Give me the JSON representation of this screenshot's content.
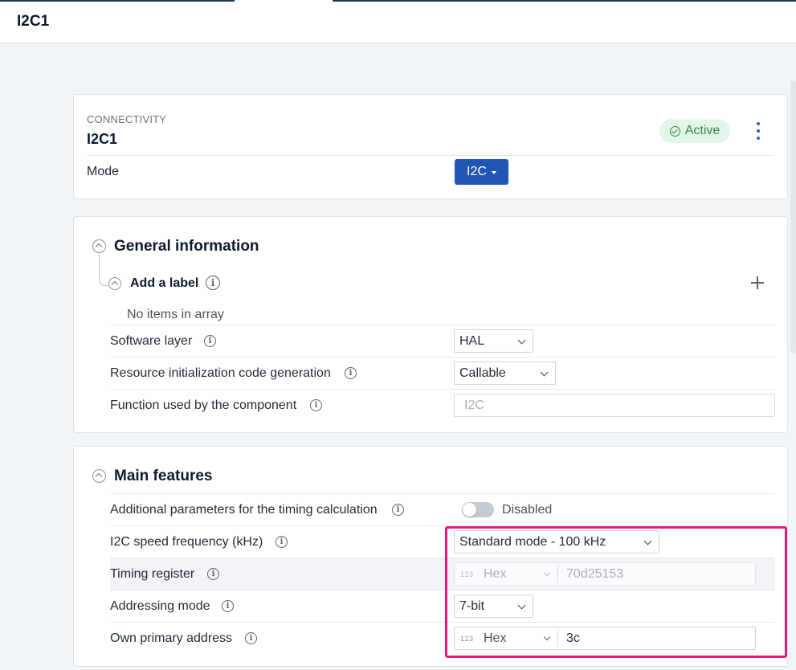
{
  "header": {
    "title": "I2C1"
  },
  "component": {
    "category": "CONNECTIVITY",
    "name": "I2C1",
    "status": "Active",
    "status_color": "#2e8a48",
    "menu_icon": "kebab-icon",
    "mode_label": "Mode",
    "mode_value": "I2C",
    "accent": "#2156b4"
  },
  "general": {
    "title": "General information",
    "add_label": "Add a label",
    "empty_text": "No items in array",
    "software_layer": {
      "label": "Software layer",
      "value": "HAL"
    },
    "init_codegen": {
      "label": "Resource initialization code generation",
      "value": "Callable"
    },
    "function_used": {
      "label": "Function used by the component",
      "placeholder": "I2C"
    }
  },
  "main": {
    "title": "Main features",
    "timing_params": {
      "label": "Additional parameters for the timing calculation",
      "state": "Disabled",
      "enabled": false
    },
    "speed": {
      "label": "I2C speed frequency (kHz)",
      "value": "Standard mode - 100 kHz"
    },
    "timing_register": {
      "label": "Timing register",
      "format_icon": "123",
      "format": "Hex",
      "value": "70d25153",
      "disabled": true
    },
    "addressing": {
      "label": "Addressing mode",
      "value": "7-bit"
    },
    "own_address": {
      "label": "Own primary address",
      "format_icon": "123",
      "format": "Hex",
      "value": "3c"
    }
  },
  "highlight_color": "#e8197d"
}
